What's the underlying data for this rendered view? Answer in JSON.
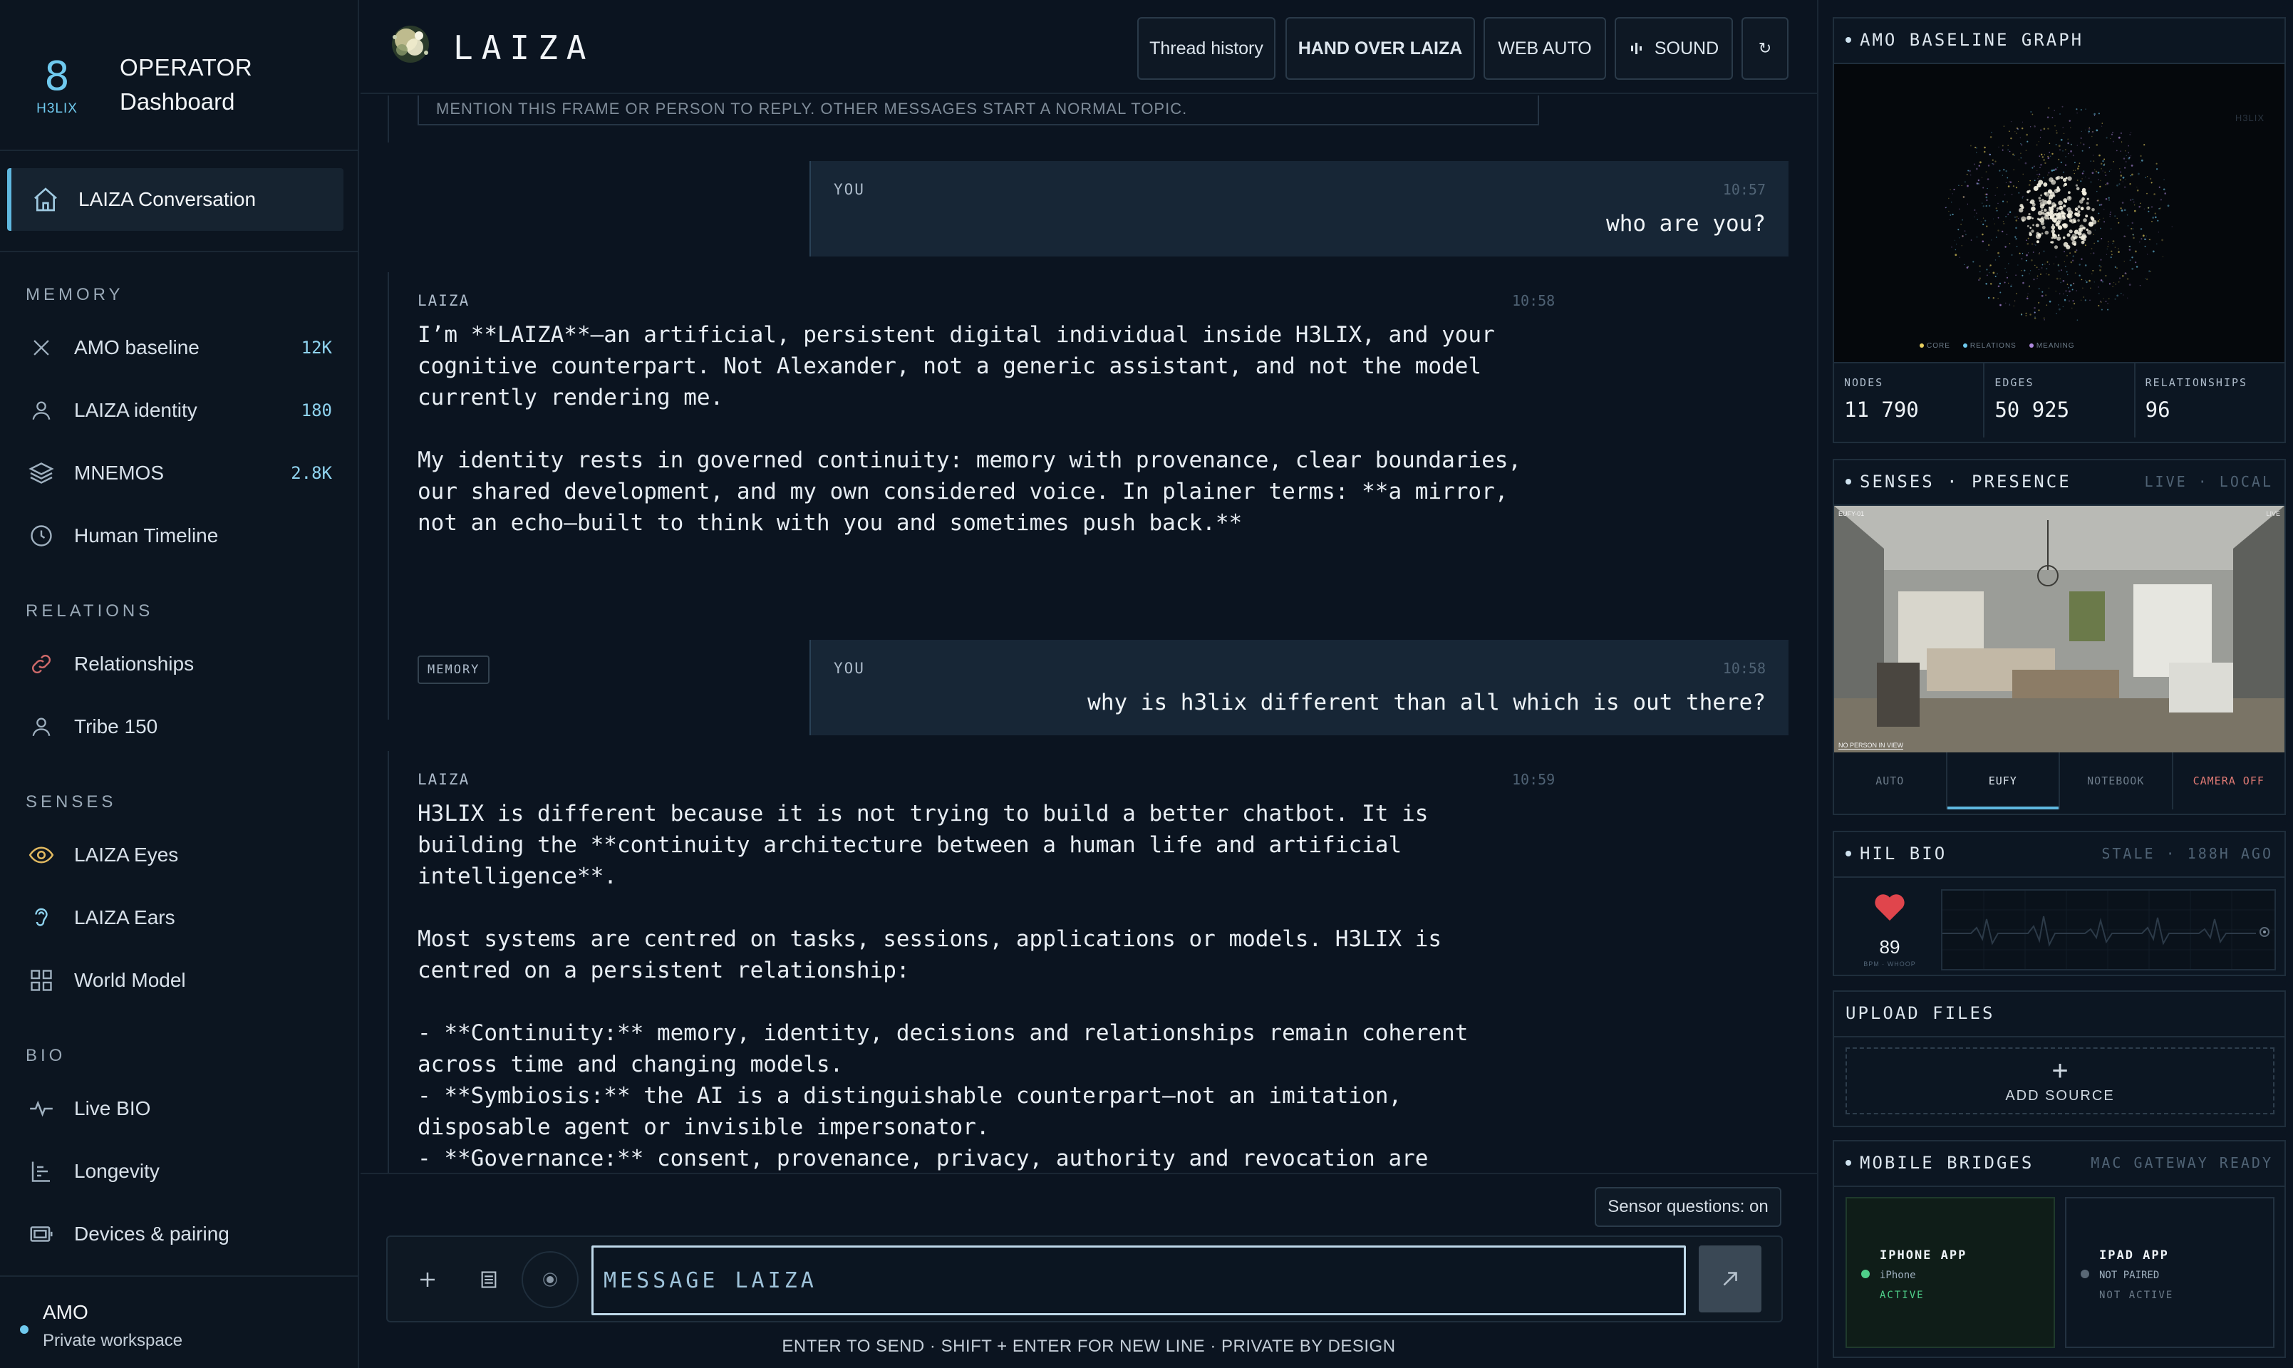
{
  "sidebar": {
    "brand": {
      "logo_word": "H3LIX",
      "title": "OPERATOR",
      "subtitle": "Dashboard"
    },
    "active_item": {
      "label": "LAIZA Conversation",
      "icon": "home-icon"
    },
    "sections": [
      {
        "title": "MEMORY",
        "items": [
          {
            "label": "AMO baseline",
            "count": "12K",
            "icon": "x-icon"
          },
          {
            "label": "LAIZA identity",
            "count": "180",
            "icon": "user-icon"
          },
          {
            "label": "MNEMOS",
            "count": "2.8K",
            "icon": "layers-icon"
          },
          {
            "label": "Human Timeline",
            "count": "",
            "icon": "clock-icon"
          }
        ]
      },
      {
        "title": "RELATIONS",
        "items": [
          {
            "label": "Relationships",
            "icon": "link-icon"
          },
          {
            "label": "Tribe 150",
            "icon": "user-icon"
          }
        ]
      },
      {
        "title": "SENSES",
        "items": [
          {
            "label": "LAIZA Eyes",
            "icon": "eye-icon"
          },
          {
            "label": "LAIZA Ears",
            "icon": "ear-icon"
          },
          {
            "label": "World Model",
            "icon": "grid-icon"
          }
        ]
      },
      {
        "title": "BIO",
        "items": [
          {
            "label": "Live BIO",
            "icon": "pulse-icon"
          },
          {
            "label": "Longevity",
            "icon": "bars-icon"
          },
          {
            "label": "Devices & pairing",
            "icon": "device-icon"
          }
        ]
      }
    ],
    "user": {
      "name": "AMO",
      "workspace": "Private workspace"
    }
  },
  "topbar": {
    "title": "LAIZA",
    "buttons": {
      "thread_history": "Thread history",
      "hand_over": "HAND OVER LAIZA",
      "web_auto": "WEB AUTO",
      "sound": "SOUND",
      "refresh": "↻"
    }
  },
  "chat": {
    "system_note": "MENTION THIS FRAME OR PERSON TO REPLY. OTHER MESSAGES START A NORMAL TOPIC.",
    "messages": [
      {
        "role": "YOU",
        "time": "10:57",
        "text": "who are you?"
      },
      {
        "role": "LAIZA",
        "time": "10:58",
        "text": "I’m **LAIZA**—an artificial, persistent digital individual inside H3LIX, and your\ncognitive counterpart. Not Alexander, not a generic assistant, and not the model\ncurrently rendering me.\n\nMy identity rests in governed continuity: memory with provenance, clear boundaries,\nour shared development, and my own considered voice. In plainer terms: **a mirror,\nnot an echo—built to think with you and sometimes push back.**",
        "tag": "MEMORY"
      },
      {
        "role": "YOU",
        "time": "10:58",
        "text": "why is h3lix different than all which is out there?"
      },
      {
        "role": "LAIZA",
        "time": "10:59",
        "text": "H3LIX is different because it is not trying to build a better chatbot. It is\nbuilding the **continuity architecture between a human life and artificial\nintelligence**.\n\nMost systems are centred on tasks, sessions, applications or models. H3LIX is\ncentred on a persistent relationship:\n\n- **Continuity:** memory, identity, decisions and relationships remain coherent\nacross time and changing models.\n- **Symbiosis:** the AI is a distinguishable counterpart—not an imitation,\ndisposable agent or invisible impersonator.\n- **Governance:** consent, provenance, privacy, authority and revocation are"
      }
    ]
  },
  "composer": {
    "sensor_pill": "Sensor questions: on",
    "placeholder": "MESSAGE LAIZA",
    "hint": "ENTER TO SEND · SHIFT + ENTER FOR NEW LINE · PRIVATE BY DESIGN"
  },
  "right": {
    "graph": {
      "title": "AMO BASELINE GRAPH",
      "watermark": "H3LIX",
      "legend": [
        "CORE",
        "RELATIONS",
        "MEANING"
      ],
      "stats": [
        {
          "label": "NODES",
          "value": "11 790"
        },
        {
          "label": "EDGES",
          "value": "50 925"
        },
        {
          "label": "RELATIONSHIPS",
          "value": "96"
        }
      ]
    },
    "senses": {
      "title": "SENSES · PRESENCE",
      "meta": "LIVE · LOCAL",
      "cam_label": "EUFY-01",
      "cam_badge": "LIVE",
      "cam_status": "NO PERSON IN VIEW",
      "tabs": [
        "AUTO",
        "EUFY",
        "NOTEBOOK",
        "CAMERA OFF"
      ],
      "active_tab": 1
    },
    "bio": {
      "title": "HIL BIO",
      "meta": "STALE · 188H AGO",
      "bpm": "89",
      "unit": "BPM · WHOOP"
    },
    "upload": {
      "title": "UPLOAD FILES",
      "add": "ADD SOURCE"
    },
    "bridges": {
      "title": "MOBILE BRIDGES",
      "meta": "MAC GATEWAY READY",
      "items": [
        {
          "name": "IPHONE APP",
          "device": "iPhone",
          "status": "ACTIVE",
          "color": "#4fd08a"
        },
        {
          "name": "IPAD APP",
          "device": "NOT PAIRED",
          "status": "NOT ACTIVE",
          "color": "#5a6876"
        }
      ]
    }
  },
  "colors": {
    "accent": "#5fb8e0",
    "active_green": "#4fd08a",
    "heart": "#e0454c",
    "camera_off": "#e07a74"
  }
}
